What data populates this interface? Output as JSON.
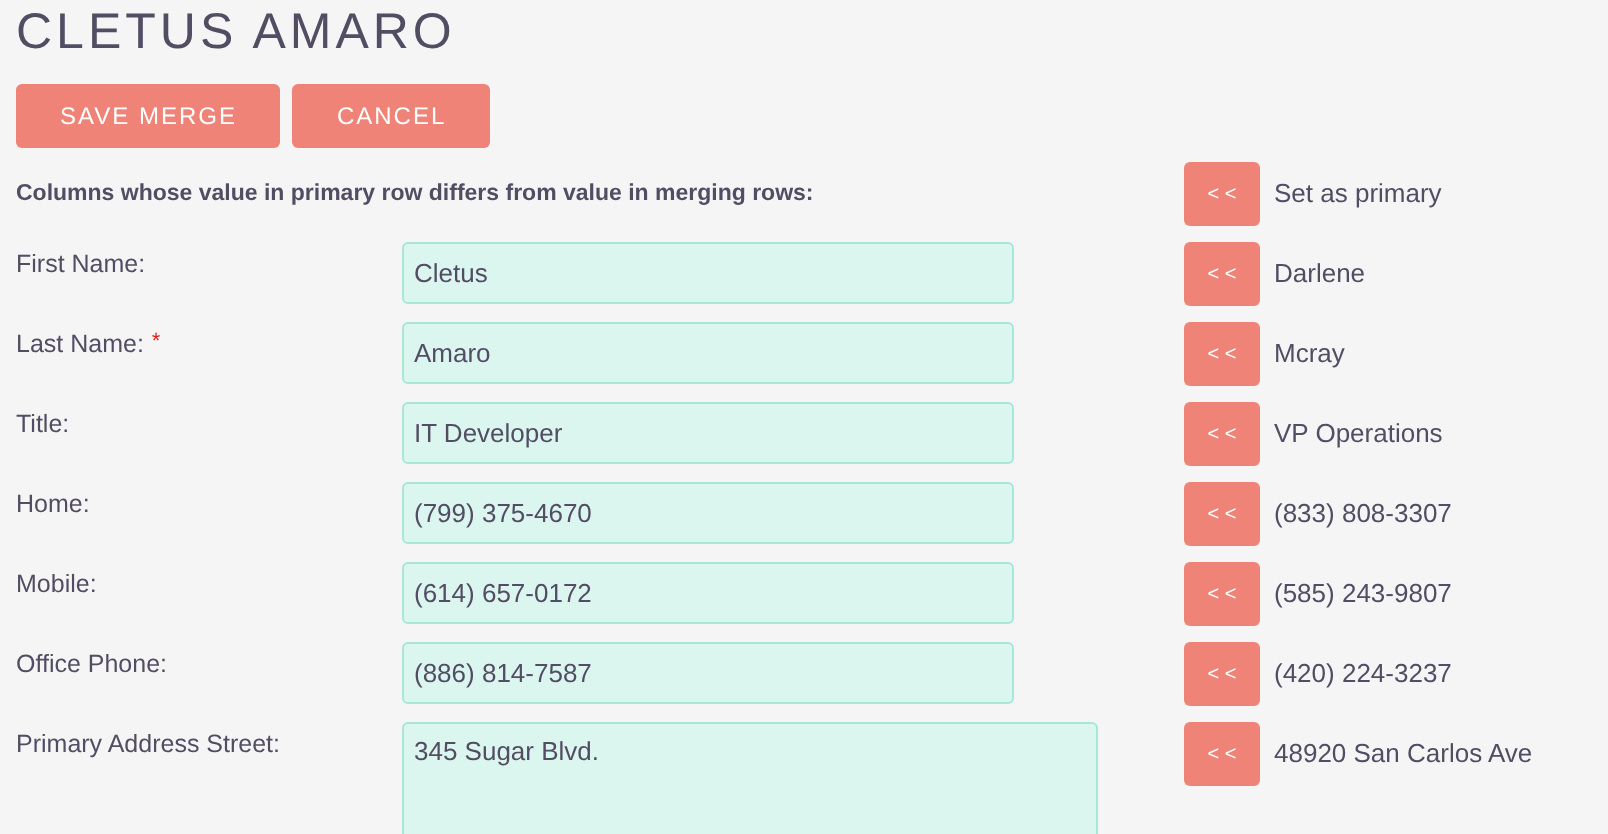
{
  "title": "CLETUS AMARO",
  "buttons": [
    "SAVE MERGE",
    "CANCEL"
  ],
  "heading": "Columns whose value in primary row differs from value in merging rows:",
  "primary_action": {
    "button": "< <",
    "label": "Set as primary"
  },
  "rows": [
    {
      "label": "First Name:",
      "kind": "input",
      "value": "Cletus",
      "button": "< <",
      "alternate": "Darlene"
    },
    {
      "label": "Last Name:",
      "required_mark": "*",
      "kind": "input",
      "value": "Amaro",
      "button": "< <",
      "alternate": "Mcray"
    },
    {
      "label": "Title:",
      "kind": "input",
      "value": "IT Developer",
      "button": "< <",
      "alternate": "VP Operations"
    },
    {
      "label": "Home:",
      "kind": "input",
      "value": "(799) 375-4670",
      "button": "< <",
      "alternate": "(833) 808-3307"
    },
    {
      "label": "Mobile:",
      "kind": "input",
      "value": "(614) 657-0172",
      "button": "< <",
      "alternate": "(585) 243-9807"
    },
    {
      "label": "Office Phone:",
      "kind": "input",
      "value": "(886) 814-7587",
      "button": "< <",
      "alternate": "(420) 224-3237"
    },
    {
      "label": "Primary Address Street:",
      "kind": "textarea",
      "value": "345 Sugar Blvd.",
      "button": "< <",
      "alternate": "48920 San Carlos Ave"
    }
  ]
}
